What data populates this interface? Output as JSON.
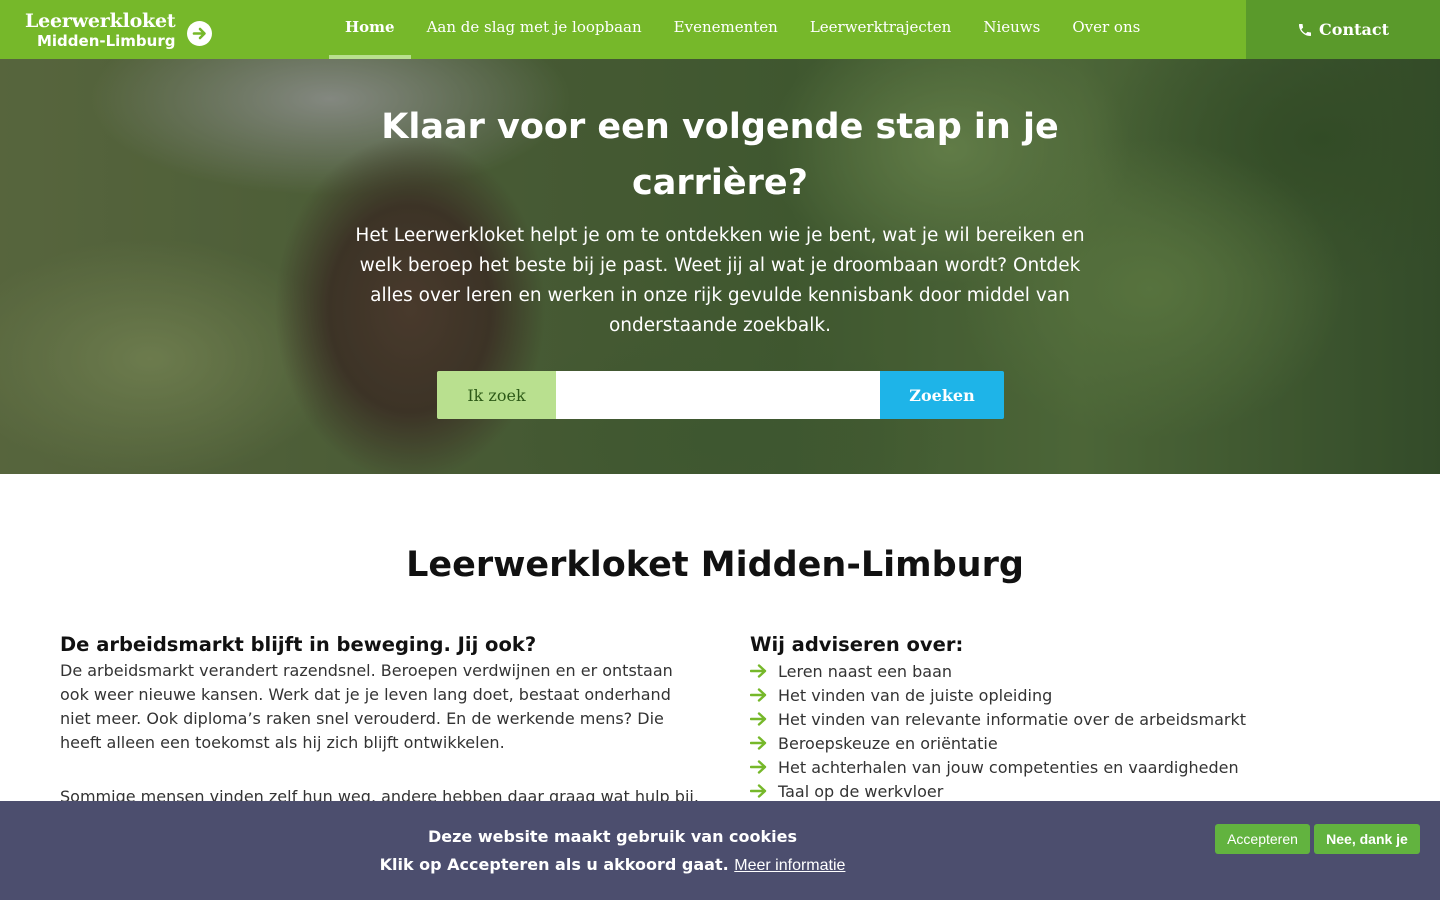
{
  "header": {
    "logo_line1": "Leerwerkloket",
    "logo_line2": "Midden-Limburg",
    "logo_icon": "arrow-right-circle-icon",
    "nav": [
      {
        "label": "Home",
        "active": true
      },
      {
        "label": "Aan de slag met je loopbaan",
        "active": false
      },
      {
        "label": "Evenementen",
        "active": false
      },
      {
        "label": "Leerwerktrajecten",
        "active": false
      },
      {
        "label": "Nieuws",
        "active": false
      },
      {
        "label": "Over ons",
        "active": false
      }
    ],
    "contact_label": "Contact",
    "contact_icon": "phone-icon"
  },
  "hero": {
    "title": "Klaar voor een volgende stap in je carrière?",
    "text": "Het Leerwerkloket helpt je om te ontdekken wie je bent, wat je wil bereiken en welk beroep het beste bij je past. Weet jij al wat je droombaan wordt? Ontdek alles over leren en werken in onze rijk gevulde kennisbank door middel van onderstaande zoekbalk.",
    "search_label": "Ik zoek",
    "search_value": "",
    "search_button": "Zoeken"
  },
  "main": {
    "title": "Leerwerkloket Midden-Limburg",
    "left_heading": "De arbeidsmarkt blijft in beweging. Jij ook?",
    "left_paragraphs": [
      "De arbeidsmarkt verandert razendsnel. Beroepen verdwijnen en er ontstaan ook weer nieuwe kansen. Werk dat je je leven lang doet, bestaat onderhand niet meer. Ook diploma’s raken snel verouderd. En de werkende mens? Die heeft alleen een toekomst als hij zich blijft ontwikkelen.",
      "Sommige mensen vinden zelf hun weg, andere hebben daar graag wat hulp bij."
    ],
    "right_heading": "Wij adviseren over:",
    "advice_items": [
      "Leren naast een baan",
      "Het vinden van de juiste opleiding",
      "Het vinden van relevante informatie over de arbeidsmarkt",
      "Beroepskeuze en oriëntatie",
      "Het achterhalen van jouw competenties en vaardigheden",
      "Taal op de werkvloer"
    ],
    "list_icon": "arrow-right-icon"
  },
  "cookie": {
    "line1": "Deze website maakt gebruik van cookies",
    "line2": "Klik op Accepteren als u akkoord gaat.",
    "more_info": "Meer informatie",
    "accept": "Accepteren",
    "decline": "Nee, dank je"
  },
  "colors": {
    "brand_green": "#76b82a",
    "contact_green": "#5a9a2b",
    "search_blue": "#1eb4e8",
    "cookie_bg": "#4c4e6e",
    "cookie_button": "#62b33f"
  }
}
